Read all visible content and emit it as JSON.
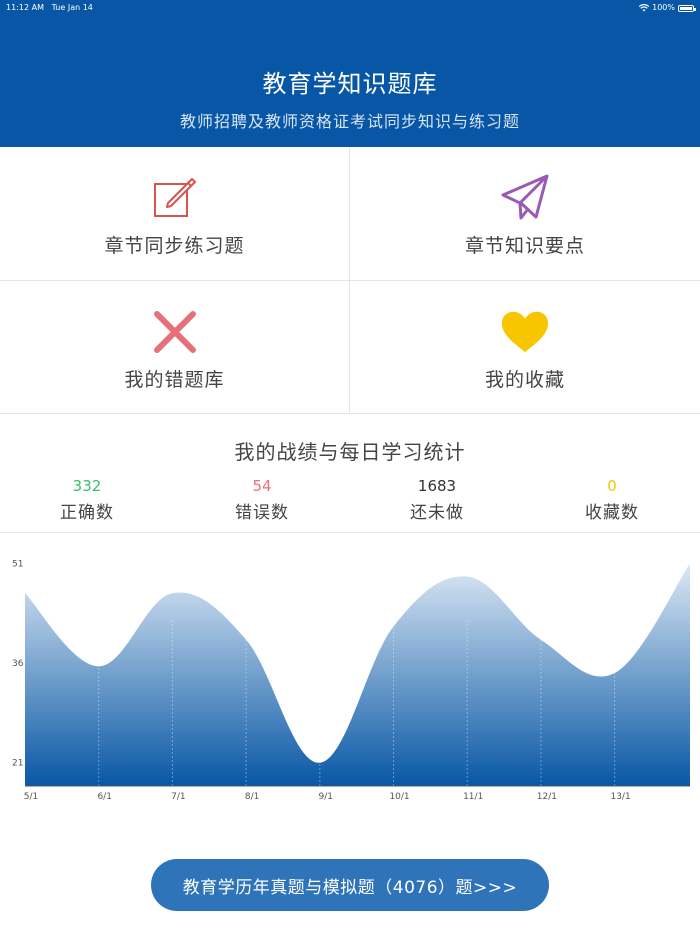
{
  "status_bar": {
    "time": "11:12 AM",
    "date": "Tue Jan 14",
    "battery": "100%"
  },
  "header": {
    "title": "教育学知识题库",
    "subtitle": "教师招聘及教师资格证考试同步知识与练习题",
    "background": "#0857a6"
  },
  "menu": {
    "items": [
      {
        "label": "章节同步练习题",
        "icon": "edit-icon",
        "color": "#d9534f"
      },
      {
        "label": "章节知识要点",
        "icon": "paper-plane-icon",
        "color": "#9b59b6"
      },
      {
        "label": "我的错题库",
        "icon": "cross-icon",
        "color": "#e8707a"
      },
      {
        "label": "我的收藏",
        "icon": "heart-icon",
        "color": "#f7c600"
      }
    ]
  },
  "stats": {
    "title": "我的战绩与每日学习统计",
    "items": [
      {
        "value": "332",
        "label": "正确数",
        "color": "#3dbd6a"
      },
      {
        "value": "54",
        "label": "错误数",
        "color": "#e8707a"
      },
      {
        "value": "1683",
        "label": "还未做",
        "color": "#333333"
      },
      {
        "value": "0",
        "label": "收藏数",
        "color": "#f7c600"
      }
    ]
  },
  "chart_data": {
    "type": "area",
    "categories": [
      "5/1",
      "6/1",
      "7/1",
      "8/1",
      "9/1",
      "10/1",
      "11/1",
      "12/1",
      "13/1"
    ],
    "values": [
      46.5,
      35.5,
      46.5,
      39.5,
      21.0,
      41.5,
      49.0,
      39.5,
      34.5,
      51.0
    ],
    "yticks": [
      21,
      36,
      51
    ],
    "ylim": [
      17.5,
      51.5
    ],
    "grid": true,
    "fill_top_color": "#dce8f4",
    "fill_bottom_color": "#0857a6"
  },
  "cta": {
    "label": "教育学历年真题与模拟题（4076）题>>>"
  }
}
